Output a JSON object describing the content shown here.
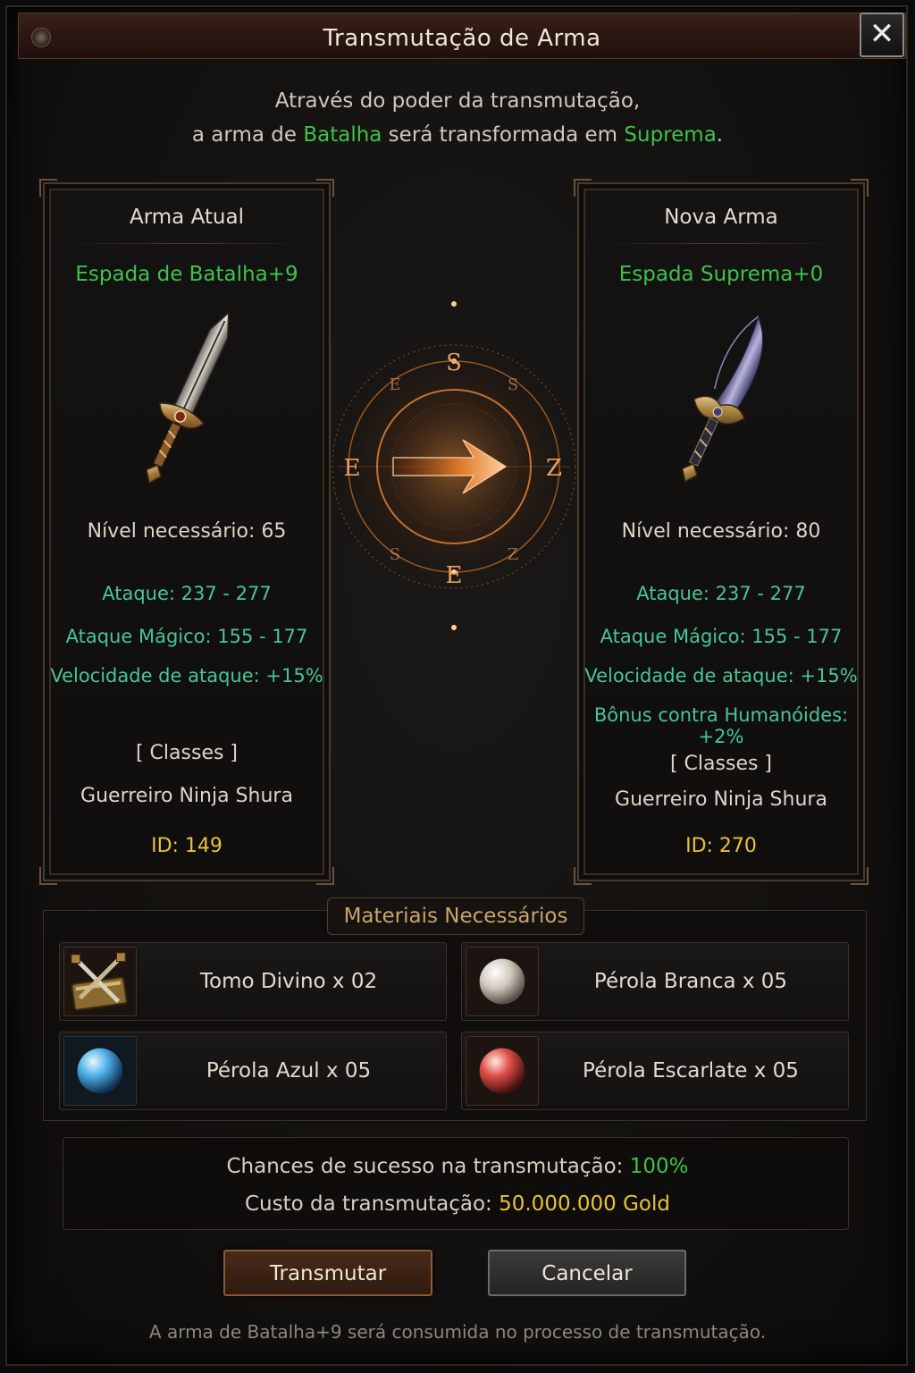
{
  "window": {
    "title": "Transmutação de Arma",
    "close_glyph": "✕"
  },
  "intro": {
    "line1": "Através do poder da transmutação,",
    "line2_prefix": "a arma de ",
    "line2_from": "Batalha",
    "line2_mid": " será transformada em ",
    "line2_to": "Suprema",
    "line2_suffix": "."
  },
  "current_weapon": {
    "header": "Arma Atual",
    "name": "Espada de Batalha+9",
    "required_level": "Nível necessário: 65",
    "stats": [
      "Ataque: 237 - 277",
      "Ataque Mágico: 155 - 177",
      "Velocidade de ataque: +15%"
    ],
    "classes_header": "[ Classes ]",
    "classes": "Guerreiro Ninja Shura",
    "id": "ID: 149",
    "icon": "broadsword-icon"
  },
  "new_weapon": {
    "header": "Nova Arma",
    "name": "Espada Suprema+0",
    "required_level": "Nível necessário: 80",
    "stats": [
      "Ataque: 237 - 277",
      "Ataque Mágico: 155 - 177",
      "Velocidade de ataque: +15%",
      "Bônus contra Humanóides: +2%"
    ],
    "classes_header": "[ Classes ]",
    "classes": "Guerreiro Ninja Shura",
    "id": "ID: 270",
    "icon": "curved-blade-icon"
  },
  "compass": {
    "letters": [
      "S",
      "E",
      "E",
      "Z",
      "E",
      "S",
      "Z",
      "E"
    ]
  },
  "materials": {
    "label": "Materiais Necessários",
    "items": [
      {
        "text": "Tomo Divino x 02",
        "icon": "divine-tome-icon"
      },
      {
        "text": "Pérola Branca x 05",
        "icon": "white-pearl-icon",
        "color": "#e8e2d6"
      },
      {
        "text": "Pérola Azul x 05",
        "icon": "blue-pearl-icon",
        "color": "#4fb0e8"
      },
      {
        "text": "Pérola Escarlate x 05",
        "icon": "scarlet-pearl-icon",
        "color": "#e0504a"
      }
    ]
  },
  "info": {
    "chance_label": "Chances de sucesso na transmutação: ",
    "chance_value": "100%",
    "cost_label": "Custo da transmutação: ",
    "cost_value": "50.000.000 Gold"
  },
  "buttons": {
    "transmute": "Transmutar",
    "cancel": "Cancelar"
  },
  "footnote": "A arma de Batalha+9 será consumida no processo de transmutação.",
  "colors": {
    "accent_green": "#3fc14c",
    "gold": "#e8c23a",
    "stat_teal": "#49c49a",
    "compass_orange": "#ff9a3a"
  }
}
